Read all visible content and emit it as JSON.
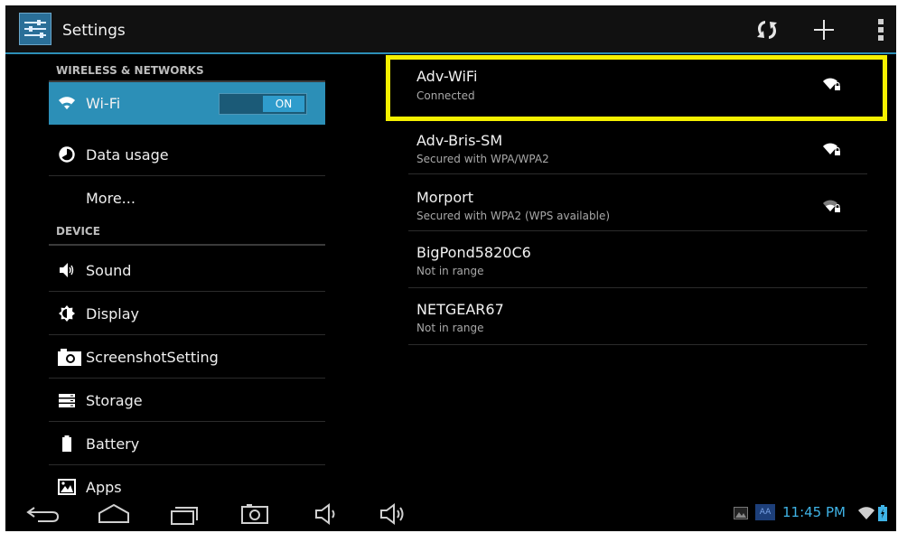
{
  "action_bar": {
    "title": "Settings",
    "icons": [
      "settings-icon",
      "wps-scan-icon",
      "add-icon",
      "overflow-menu-icon"
    ]
  },
  "menu": {
    "section_wireless": "WIRELESS & NETWORKS",
    "section_device": "DEVICE",
    "wifi": {
      "label": "Wi-Fi",
      "toggle": "ON",
      "icon": "wifi-icon"
    },
    "data_usage": {
      "label": "Data usage",
      "icon": "data-usage-icon"
    },
    "more": {
      "label": "More..."
    },
    "sound": {
      "label": "Sound",
      "icon": "sound-icon"
    },
    "display": {
      "label": "Display",
      "icon": "display-icon"
    },
    "screenshot": {
      "label": "ScreenshotSetting",
      "icon": "camera-icon"
    },
    "storage": {
      "label": "Storage",
      "icon": "storage-icon"
    },
    "battery": {
      "label": "Battery",
      "icon": "battery-icon"
    },
    "apps": {
      "label": "Apps",
      "icon": "apps-icon"
    }
  },
  "networks": [
    {
      "name": "Adv-WiFi",
      "status": "Connected",
      "signal": "strong",
      "secured": true
    },
    {
      "name": "Adv-Bris-SM",
      "status": "Secured with WPA/WPA2",
      "signal": "strong",
      "secured": true
    },
    {
      "name": "Morport",
      "status": "Secured with WPA2 (WPS available)",
      "signal": "medium",
      "secured": true
    },
    {
      "name": "BigPond5820C6",
      "status": "Not in range"
    },
    {
      "name": "NETGEAR67",
      "status": "Not in range"
    }
  ],
  "system_bar": {
    "clock": "11:45 PM",
    "aa_label": "AA",
    "nav_icons": [
      "back-icon",
      "home-icon",
      "recent-apps-icon",
      "screenshot-icon",
      "volume-down-icon",
      "volume-up-icon"
    ]
  },
  "colors": {
    "accent": "#2c8fb7",
    "highlight": "#f5f000",
    "clock": "#3fb3e6",
    "background": "#000000"
  }
}
